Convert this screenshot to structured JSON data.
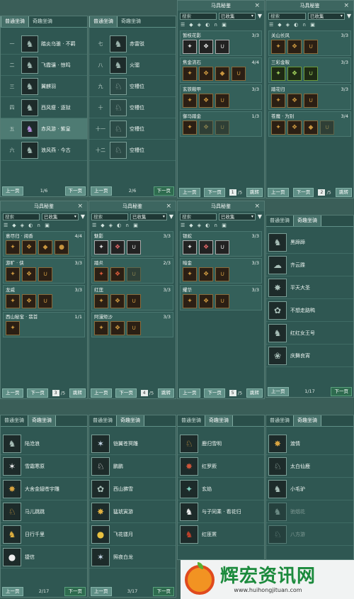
{
  "tabs": {
    "normal": "普通坐骑",
    "fun": "奇趣坐骑"
  },
  "nav": {
    "prev": "上一页",
    "next": "下一页",
    "jump": "跳转"
  },
  "codex": {
    "title": "马具秘鉴",
    "search_placeholder": "搜索",
    "filter_value": "已收集",
    "close": "×",
    "filter_icon": "▼"
  },
  "panel1": {
    "rows": [
      {
        "num": "一",
        "name": "踏炎乌骓 · 不羁"
      },
      {
        "num": "二",
        "name": "飞霞骧 · 惊鸣"
      },
      {
        "num": "三",
        "name": "翼麒羽"
      },
      {
        "num": "四",
        "name": "西风瘦 · 逐狱"
      },
      {
        "num": "五",
        "name": "赤风游 · 紫皇"
      },
      {
        "num": "六",
        "name": "浪风燕 · 今古"
      }
    ],
    "page": "1/6"
  },
  "panel2": {
    "rows": [
      {
        "num": "七",
        "name": "赤雷驳"
      },
      {
        "num": "八",
        "name": "火骝"
      },
      {
        "num": "九",
        "name": "空槽位"
      },
      {
        "num": "十",
        "name": "空槽位"
      },
      {
        "num": "十一",
        "name": "空槽位"
      },
      {
        "num": "十二",
        "name": "空槽位"
      }
    ],
    "page": "2/6"
  },
  "panel3": {
    "groups": [
      {
        "name": "暂枝花影",
        "count": "3/3"
      },
      {
        "name": "焦金流石",
        "count": "4/4"
      },
      {
        "name": "玄铁鞍甲",
        "count": "3/3"
      },
      {
        "name": "御马踏金",
        "count": "1/3"
      }
    ],
    "page_num": "1",
    "page_total": "/5"
  },
  "panel4": {
    "groups": [
      {
        "name": "关山长风",
        "count": "3/3"
      },
      {
        "name": "三彩金鞍",
        "count": "3/3"
      },
      {
        "name": "踏花归",
        "count": "3/3"
      },
      {
        "name": "苍魔 · 为别",
        "count": "3/4"
      }
    ],
    "page_num": "2",
    "page_total": "/5"
  },
  "panel5": {
    "groups": [
      {
        "name": "意尽归 · 阅香",
        "count": "4/4"
      },
      {
        "name": "游旷 · 侠",
        "count": "3/3"
      },
      {
        "name": "龙威",
        "count": "3/3"
      },
      {
        "name": "西山秘宝 · 翡首",
        "count": "1/1"
      }
    ],
    "page_num": "3",
    "page_total": "/5"
  },
  "panel6": {
    "groups": [
      {
        "name": "魅影",
        "count": "3/3"
      },
      {
        "name": "踏炎",
        "count": "2/3"
      },
      {
        "name": "红莲",
        "count": "3/3"
      },
      {
        "name": "阿漫矩沙",
        "count": "3/3"
      }
    ],
    "page_num": "4",
    "page_total": "/5"
  },
  "panel7": {
    "groups": [
      {
        "name": "银蛇",
        "count": "3/3"
      },
      {
        "name": "暗金",
        "count": "3/3"
      },
      {
        "name": "耀华",
        "count": "3/3"
      }
    ],
    "page_num": "5",
    "page_total": "/5"
  },
  "panel8": {
    "rows": [
      "黑蹄蹄",
      "齐云蹀",
      "平天大圣",
      "不想走路鸭",
      "红红女王号",
      "庆舞良宵"
    ],
    "page": "1/17"
  },
  "panel9": {
    "rows": [
      "陆沧浪",
      "雪霜寒原",
      "大舍金翅苍宇雕",
      "马儿跳跳",
      "日行千里",
      "捷信"
    ],
    "page": "2/17"
  },
  "panel10": {
    "rows": [
      "铠翼苍冥雕",
      "鹏鹏",
      "西山拂雪",
      "猛琥寅游",
      "飞花镂月",
      "照夜白龙"
    ],
    "page": "3/17"
  },
  "panel11": {
    "rows": [
      "鹿归雪明",
      "红罗厥",
      "玄焰",
      "与子同乘 · 看花归",
      "红匪罴"
    ]
  },
  "panel12": {
    "rows": [
      "渡情",
      "太白仙鹿",
      "小毛驴",
      "驰烟花",
      "八方游"
    ]
  },
  "watermark": {
    "text": "辉宏资讯网",
    "url": "www.huihongjituan.com"
  }
}
